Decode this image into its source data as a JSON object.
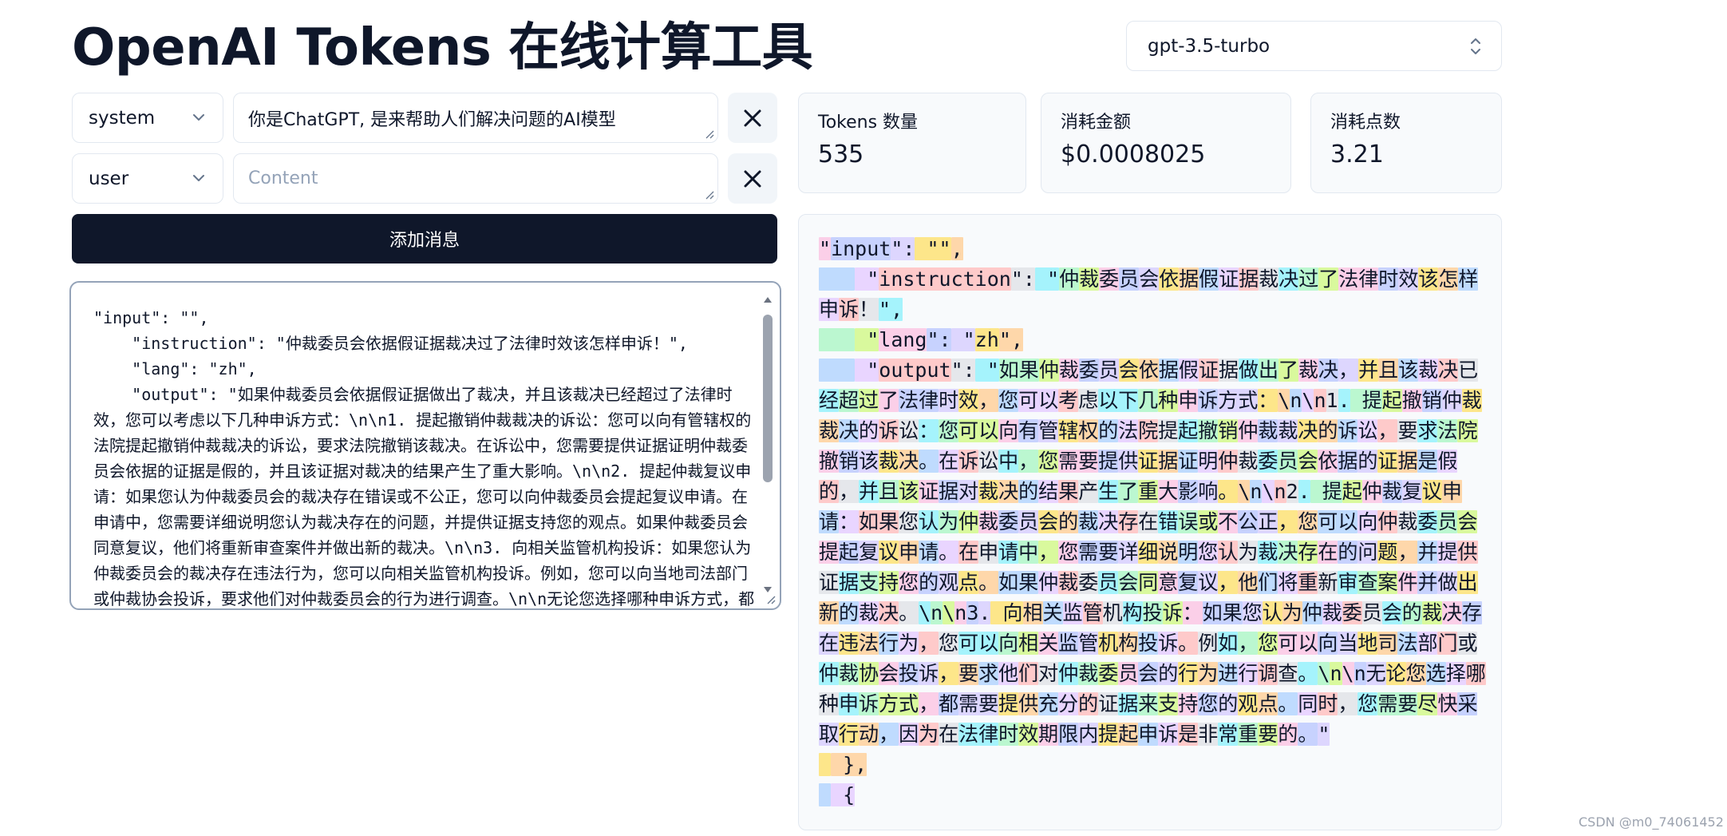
{
  "header": {
    "title": "OpenAI Tokens 在线计算工具",
    "model": "gpt-3.5-turbo"
  },
  "messages": [
    {
      "role": "system",
      "content": "你是ChatGPT, 是来帮助人们解决问题的AI模型",
      "placeholder": "Content"
    },
    {
      "role": "user",
      "content": "",
      "placeholder": "Content"
    }
  ],
  "add_button_label": "添加消息",
  "json_input": "\"input\": \"\",\n    \"instruction\": \"仲裁委员会依据假证据裁决过了法律时效该怎样申诉！\",\n    \"lang\": \"zh\",\n    \"output\": \"如果仲裁委员会依据假证据做出了裁决，并且该裁决已经超过了法律时效，您可以考虑以下几种申诉方式：\\n\\n1. 提起撤销仲裁裁决的诉讼：您可以向有管辖权的法院提起撤销仲裁裁决的诉讼，要求法院撤销该裁决。在诉讼中，您需要提供证据证明仲裁委员会依据的证据是假的，并且该证据对裁决的结果产生了重大影响。\\n\\n2. 提起仲裁复议申请：如果您认为仲裁委员会的裁决存在错误或不公正，您可以向仲裁委员会提起复议申请。在申请中，您需要详细说明您认为裁决存在的问题，并提供证据支持您的观点。如果仲裁委员会同意复议，他们将重新审查案件并做出新的裁决。\\n\\n3. 向相关监管机构投诉：如果您认为仲裁委员会的裁决存在违法行为，您可以向相关监管机构投诉。例如，您可以向当地司法部门或仲裁协会投诉，要求他们对仲裁委员会的行为进行调查。\\n\\n无论您选择哪种申诉方式，都需要提供充分的证据来支持您的观点。同时，您需要尽快采取行动，因为在法律时效期限内提起申诉是非常重要的。\"\n  },\n  {",
  "stats": {
    "tokens_label": "Tokens 数量",
    "tokens_value": "535",
    "cost_label": "消耗金额",
    "cost_value": "$0.0008025",
    "points_label": "消耗点数",
    "points_value": "3.21"
  },
  "token_colors": [
    "#fde68a",
    "#bbf7d0",
    "#bfdbfe",
    "#fbcfe8",
    "#fecaca",
    "#ddd6fe",
    "#a5f3fc",
    "#fed7aa",
    "#d9f99d",
    "#e9d5ff",
    "#c7d2fe",
    "#e5e7eb"
  ],
  "tokens": [
    "\"",
    "input",
    "\":",
    " \"\"",
    ",\n",
    "   ",
    " \"",
    "instruction",
    "\":",
    " \"",
    "仲",
    "裁",
    "委",
    "员",
    "会",
    "依",
    "据",
    "假",
    "证",
    "据",
    "裁",
    "决",
    "过",
    "了",
    "法律",
    "时",
    "效",
    "该",
    "怎",
    "样",
    "申",
    "诉",
    "！",
    "\",\n",
    "   ",
    " \"",
    "lang",
    "\":",
    " \"",
    "zh",
    "\",\n",
    "   ",
    " \"",
    "output",
    "\":",
    " \"",
    "如果",
    "仲",
    "裁",
    "委",
    "员",
    "会",
    "依",
    "据",
    "假",
    "证",
    "据",
    "做",
    "出",
    "了",
    "裁",
    "决",
    "，",
    "并",
    "且",
    "该",
    "裁",
    "决",
    "已",
    "经",
    "超",
    "过",
    "了",
    "法律",
    "时",
    "效",
    "，",
    "您",
    "可以",
    "考",
    "虑",
    "以下",
    "几",
    "种",
    "申",
    "诉",
    "方式",
    "：",
    "\\",
    "n",
    "\\",
    "n",
    "1",
    ".",
    " 提",
    "起",
    "撤",
    "销",
    "仲",
    "裁",
    "裁",
    "决",
    "的",
    "诉",
    "讼",
    "：",
    "您",
    "可以",
    "向",
    "有",
    "管",
    "辖",
    "权",
    "的",
    "法",
    "院",
    "提",
    "起",
    "撤",
    "销",
    "仲",
    "裁",
    "裁",
    "决",
    "的",
    "诉",
    "讼",
    "，",
    "要",
    "求",
    "法",
    "院",
    "撤",
    "销",
    "该",
    "裁",
    "决",
    "。",
    "在",
    "诉",
    "讼",
    "中",
    "，",
    "您",
    "需要",
    "提",
    "供",
    "证",
    "据",
    "证",
    "明",
    "仲",
    "裁",
    "委",
    "员",
    "会",
    "依",
    "据",
    "的",
    "证",
    "据",
    "是",
    "假",
    "的",
    "，",
    "并",
    "且",
    "该",
    "证",
    "据",
    "对",
    "裁",
    "决",
    "的",
    "结",
    "果",
    "产",
    "生",
    "了",
    "重",
    "大",
    "影",
    "响",
    "。",
    "\\",
    "n",
    "\\",
    "n",
    "2",
    ".",
    " 提",
    "起",
    "仲",
    "裁",
    "复",
    "议",
    "申",
    "请",
    "：",
    "如果",
    "您",
    "认",
    "为",
    "仲",
    "裁",
    "委",
    "员",
    "会",
    "的",
    "裁",
    "决",
    "存",
    "在",
    "错",
    "误",
    "或",
    "不",
    "公",
    "正",
    "，",
    "您",
    "可以",
    "向",
    "仲",
    "裁",
    "委",
    "员",
    "会",
    "提",
    "起",
    "复",
    "议",
    "申",
    "请",
    "。",
    "在",
    "申",
    "请",
    "中",
    "，",
    "您",
    "需要",
    "详",
    "细",
    "说",
    "明",
    "您",
    "认",
    "为",
    "裁",
    "决",
    "存",
    "在",
    "的",
    "问",
    "题",
    "，",
    "并",
    "提",
    "供",
    "证",
    "据",
    "支",
    "持",
    "您",
    "的",
    "观",
    "点",
    "。",
    "如果",
    "仲",
    "裁",
    "委",
    "员",
    "会",
    "同",
    "意",
    "复",
    "议",
    "，",
    "他",
    "们",
    "将",
    "重",
    "新",
    "审",
    "查",
    "案",
    "件",
    "并",
    "做",
    "出",
    "新",
    "的",
    "裁",
    "决",
    "。",
    "\\",
    "n",
    "\\",
    "n",
    "3",
    ".",
    " 向",
    "相",
    "关",
    "监",
    "管",
    "机",
    "构",
    "投",
    "诉",
    "：",
    "如果",
    "您",
    "认",
    "为",
    "仲",
    "裁",
    "委",
    "员",
    "会",
    "的",
    "裁",
    "决",
    "存",
    "在",
    "违",
    "法",
    "行",
    "为",
    "，",
    "您",
    "可以",
    "向",
    "相",
    "关",
    "监",
    "管",
    "机",
    "构",
    "投",
    "诉",
    "。",
    "例",
    "如",
    "，",
    "您",
    "可以",
    "向",
    "当",
    "地",
    "司",
    "法",
    "部",
    "门",
    "或",
    "仲",
    "裁",
    "协",
    "会",
    "投",
    "诉",
    "，",
    "要",
    "求",
    "他",
    "们",
    "对",
    "仲",
    "裁",
    "委",
    "员",
    "会",
    "的",
    "行",
    "为",
    "进",
    "行",
    "调",
    "查",
    "。",
    "\\",
    "n",
    "\\",
    "n",
    "无",
    "论",
    "您",
    "选",
    "择",
    "哪",
    "种",
    "申",
    "诉",
    "方式",
    "，",
    "都",
    "需要",
    "提",
    "供",
    "充",
    "分",
    "的",
    "证",
    "据",
    "来",
    "支",
    "持",
    "您",
    "的",
    "观",
    "点",
    "。",
    "同",
    "时",
    "，",
    "您",
    "需要",
    "尽",
    "快",
    "采",
    "取",
    "行",
    "动",
    "，",
    "因",
    "为",
    "在",
    "法律",
    "时",
    "效",
    "期",
    "限",
    "内",
    "提",
    "起",
    "申",
    "诉",
    "是",
    "非",
    "常",
    "重",
    "要",
    "的",
    "。",
    "\"\n",
    " ",
    " },\n",
    " ",
    " {"
  ],
  "watermark": "CSDN @m0_74061452"
}
